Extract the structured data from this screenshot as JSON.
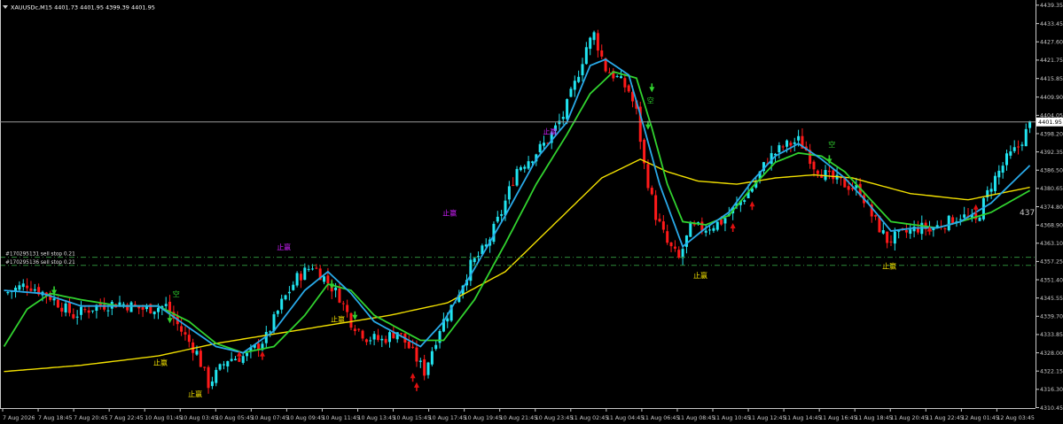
{
  "header": {
    "menu_icon": "triangle-down-icon",
    "title": "XAUUSDc,M15  4401.73 4401.95 4399.39 4401.95"
  },
  "chart_data": {
    "type": "candlestick",
    "symbol": "XAUUSDc",
    "timeframe": "M15",
    "ylim": [
      4310.3,
      4441.0
    ],
    "y_ticks": [
      "4439.35",
      "4433.45",
      "4427.60",
      "4421.75",
      "4415.85",
      "4409.90",
      "4404.05",
      "4398.20",
      "4392.35",
      "4386.50",
      "4380.65",
      "4374.80",
      "4368.90",
      "4363.10",
      "4357.25",
      "4351.40",
      "4345.55",
      "4339.70",
      "4333.85",
      "4328.00",
      "4322.15",
      "4316.30",
      "4310.45"
    ],
    "x_ticks": [
      "7 Aug 2026",
      "7 Aug 18:45",
      "7 Aug 20:45",
      "7 Aug 22:45",
      "10 Aug 01:45",
      "10 Aug 03:45",
      "10 Aug 05:45",
      "10 Aug 07:45",
      "10 Aug 09:45",
      "10 Aug 11:45",
      "10 Aug 13:45",
      "10 Aug 15:45",
      "10 Aug 17:45",
      "10 Aug 19:45",
      "10 Aug 21:45",
      "10 Aug 23:45",
      "11 Aug 02:45",
      "11 Aug 04:45",
      "11 Aug 06:45",
      "11 Aug 08:45",
      "11 Aug 10:45",
      "11 Aug 12:45",
      "11 Aug 14:45",
      "11 Aug 16:45",
      "11 Aug 18:45",
      "11 Aug 20:45",
      "11 Aug 22:45",
      "12 Aug 01:45",
      "12 Aug 03:45"
    ],
    "current_price": "4401.95",
    "side_value": "437",
    "close_anchors": [
      [
        0,
        4347
      ],
      [
        6,
        4350
      ],
      [
        12,
        4346
      ],
      [
        18,
        4340
      ],
      [
        24,
        4343
      ],
      [
        30,
        4344
      ],
      [
        36,
        4342
      ],
      [
        42,
        4343
      ],
      [
        46,
        4335
      ],
      [
        50,
        4328
      ],
      [
        53,
        4318
      ],
      [
        58,
        4326
      ],
      [
        63,
        4327
      ],
      [
        68,
        4333
      ],
      [
        72,
        4344
      ],
      [
        76,
        4352
      ],
      [
        80,
        4356
      ],
      [
        83,
        4352
      ],
      [
        87,
        4346
      ],
      [
        90,
        4338
      ],
      [
        94,
        4333
      ],
      [
        98,
        4332
      ],
      [
        102,
        4335
      ],
      [
        106,
        4328
      ],
      [
        109,
        4322
      ],
      [
        113,
        4336
      ],
      [
        117,
        4345
      ],
      [
        121,
        4356
      ],
      [
        125,
        4362
      ],
      [
        129,
        4373
      ],
      [
        133,
        4387
      ],
      [
        137,
        4391
      ],
      [
        141,
        4396
      ],
      [
        145,
        4404
      ],
      [
        148,
        4414
      ],
      [
        151,
        4426
      ],
      [
        153,
        4430
      ],
      [
        156,
        4419
      ],
      [
        159,
        4416
      ],
      [
        162,
        4412
      ],
      [
        164,
        4405
      ],
      [
        166,
        4388
      ],
      [
        169,
        4372
      ],
      [
        172,
        4363
      ],
      [
        175,
        4358
      ],
      [
        178,
        4368
      ],
      [
        182,
        4368
      ],
      [
        186,
        4370
      ],
      [
        190,
        4375
      ],
      [
        194,
        4381
      ],
      [
        198,
        4390
      ],
      [
        202,
        4394
      ],
      [
        206,
        4396
      ],
      [
        208,
        4393
      ],
      [
        210,
        4388
      ],
      [
        214,
        4384
      ],
      [
        218,
        4382
      ],
      [
        222,
        4380
      ],
      [
        225,
        4372
      ],
      [
        229,
        4364
      ],
      [
        233,
        4366
      ],
      [
        237,
        4368
      ],
      [
        241,
        4368
      ],
      [
        245,
        4370
      ],
      [
        248,
        4372
      ],
      [
        252,
        4370
      ],
      [
        256,
        4382
      ],
      [
        260,
        4390
      ],
      [
        263,
        4394
      ],
      [
        266,
        4401
      ]
    ],
    "overlays": [
      {
        "name": "yellow-ma",
        "color": "#f2e000",
        "points": [
          [
            0,
            4322
          ],
          [
            20,
            4324
          ],
          [
            40,
            4327
          ],
          [
            55,
            4331
          ],
          [
            70,
            4334
          ],
          [
            85,
            4337
          ],
          [
            100,
            4340
          ],
          [
            115,
            4344
          ],
          [
            130,
            4354
          ],
          [
            145,
            4372
          ],
          [
            155,
            4384
          ],
          [
            165,
            4390
          ],
          [
            172,
            4386
          ],
          [
            180,
            4383
          ],
          [
            190,
            4382
          ],
          [
            200,
            4384
          ],
          [
            210,
            4385
          ],
          [
            220,
            4384
          ],
          [
            235,
            4379
          ],
          [
            250,
            4377
          ],
          [
            266,
            4381
          ]
        ]
      },
      {
        "name": "green-ma",
        "color": "#31d22f",
        "points": [
          [
            0,
            4330
          ],
          [
            6,
            4342
          ],
          [
            12,
            4347
          ],
          [
            20,
            4345
          ],
          [
            30,
            4343
          ],
          [
            40,
            4343
          ],
          [
            48,
            4338
          ],
          [
            55,
            4331
          ],
          [
            62,
            4328
          ],
          [
            70,
            4330
          ],
          [
            78,
            4340
          ],
          [
            84,
            4350
          ],
          [
            90,
            4348
          ],
          [
            96,
            4340
          ],
          [
            102,
            4336
          ],
          [
            108,
            4332
          ],
          [
            114,
            4332
          ],
          [
            122,
            4345
          ],
          [
            130,
            4363
          ],
          [
            138,
            4382
          ],
          [
            146,
            4398
          ],
          [
            152,
            4411
          ],
          [
            158,
            4418
          ],
          [
            164,
            4416
          ],
          [
            168,
            4400
          ],
          [
            172,
            4382
          ],
          [
            176,
            4370
          ],
          [
            182,
            4369
          ],
          [
            188,
            4372
          ],
          [
            194,
            4381
          ],
          [
            200,
            4389
          ],
          [
            206,
            4392
          ],
          [
            212,
            4391
          ],
          [
            218,
            4386
          ],
          [
            224,
            4378
          ],
          [
            230,
            4370
          ],
          [
            236,
            4369
          ],
          [
            242,
            4368
          ],
          [
            248,
            4370
          ],
          [
            256,
            4373
          ],
          [
            266,
            4380
          ]
        ]
      },
      {
        "name": "blue-ma",
        "color": "#29a9e8",
        "points": [
          [
            0,
            4348
          ],
          [
            10,
            4347
          ],
          [
            20,
            4343
          ],
          [
            30,
            4343
          ],
          [
            40,
            4343
          ],
          [
            48,
            4336
          ],
          [
            55,
            4330
          ],
          [
            62,
            4328
          ],
          [
            70,
            4335
          ],
          [
            78,
            4348
          ],
          [
            84,
            4354
          ],
          [
            90,
            4347
          ],
          [
            96,
            4338
          ],
          [
            102,
            4334
          ],
          [
            108,
            4330
          ],
          [
            114,
            4338
          ],
          [
            122,
            4355
          ],
          [
            130,
            4372
          ],
          [
            138,
            4390
          ],
          [
            146,
            4402
          ],
          [
            152,
            4420
          ],
          [
            156,
            4422
          ],
          [
            162,
            4417
          ],
          [
            166,
            4400
          ],
          [
            170,
            4382
          ],
          [
            176,
            4362
          ],
          [
            182,
            4368
          ],
          [
            188,
            4373
          ],
          [
            194,
            4383
          ],
          [
            200,
            4391
          ],
          [
            206,
            4395
          ],
          [
            212,
            4390
          ],
          [
            218,
            4384
          ],
          [
            224,
            4376
          ],
          [
            230,
            4367
          ],
          [
            236,
            4368
          ],
          [
            242,
            4368
          ],
          [
            248,
            4370
          ],
          [
            256,
            4376
          ],
          [
            266,
            4388
          ]
        ]
      }
    ],
    "hlines": [
      {
        "price": "4358.6",
        "label": "#170295131 sell stop 0.21"
      },
      {
        "price": "4356.0",
        "label": "#170295136 sell stop 0.21"
      }
    ],
    "annotations": [
      {
        "text": "止赢",
        "color": "#f2e000",
        "at": [
          40,
          4324
        ]
      },
      {
        "text": "止赢",
        "color": "#f2e000",
        "at": [
          49,
          4314
        ]
      },
      {
        "text": "止赢",
        "color": "#f2e000",
        "at": [
          86,
          4338
        ]
      },
      {
        "text": "止赢",
        "color": "#d020ff",
        "at": [
          72,
          4361
        ]
      },
      {
        "text": "止赢",
        "color": "#d020ff",
        "at": [
          115,
          4372
        ]
      },
      {
        "text": "止赢",
        "color": "#d020ff",
        "at": [
          141,
          4398
        ]
      },
      {
        "text": "止赢",
        "color": "#f2e000",
        "at": [
          180,
          4352
        ]
      },
      {
        "text": "止赢",
        "color": "#f2e000",
        "at": [
          229,
          4355
        ]
      },
      {
        "text": "空",
        "color": "#31d22f",
        "at": [
          45,
          4346
        ]
      },
      {
        "text": "空",
        "color": "#31d22f",
        "at": [
          168,
          4408
        ]
      },
      {
        "text": "空",
        "color": "#31d22f",
        "at": [
          215,
          4394
        ]
      }
    ],
    "signal_arrows": [
      {
        "dir": "down",
        "color": "#31d22f",
        "at": [
          13,
          4347
        ]
      },
      {
        "dir": "down",
        "color": "#31d22f",
        "at": [
          43,
          4338
        ]
      },
      {
        "dir": "down",
        "color": "#31d22f",
        "at": [
          85,
          4349
        ]
      },
      {
        "dir": "down",
        "color": "#31d22f",
        "at": [
          91,
          4339
        ]
      },
      {
        "dir": "down",
        "color": "#31d22f",
        "at": [
          167,
          4400
        ]
      },
      {
        "dir": "down",
        "color": "#31d22f",
        "at": [
          168,
          4412
        ]
      },
      {
        "dir": "down",
        "color": "#31d22f",
        "at": [
          214,
          4389
        ]
      },
      {
        "dir": "up",
        "color": "#e01010",
        "at": [
          61,
          4328
        ]
      },
      {
        "dir": "up",
        "color": "#e01010",
        "at": [
          67,
          4328
        ]
      },
      {
        "dir": "up",
        "color": "#e01010",
        "at": [
          106,
          4321
        ]
      },
      {
        "dir": "up",
        "color": "#e01010",
        "at": [
          107,
          4318
        ]
      },
      {
        "dir": "up",
        "color": "#e01010",
        "at": [
          189,
          4369
        ]
      },
      {
        "dir": "up",
        "color": "#e01010",
        "at": [
          194,
          4376
        ]
      },
      {
        "dir": "up",
        "color": "#e01010",
        "at": [
          240,
          4368
        ]
      },
      {
        "dir": "up",
        "color": "#e01010",
        "at": [
          252,
          4375
        ]
      }
    ],
    "colors": {
      "bull": "#21e4f0",
      "bear": "#ff1a1a",
      "axis": "#c8c8c8",
      "price_line": "#9a9a9a",
      "order_line": "#2e8b3a",
      "bg": "#000000"
    }
  }
}
